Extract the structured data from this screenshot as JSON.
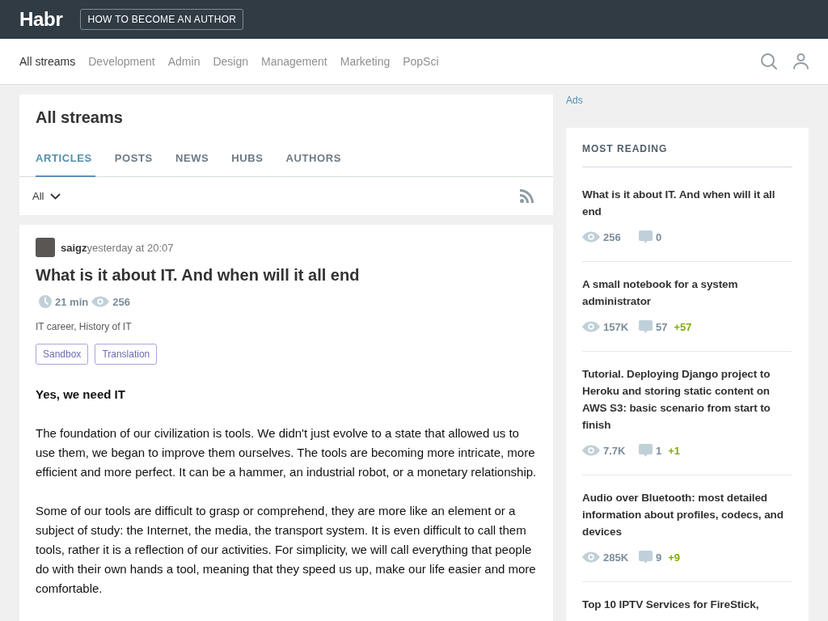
{
  "header": {
    "logo": "Habr",
    "author_button": "HOW TO BECOME AN AUTHOR"
  },
  "nav": {
    "items": [
      {
        "label": "All streams",
        "selected": true
      },
      {
        "label": "Development",
        "selected": false
      },
      {
        "label": "Admin",
        "selected": false
      },
      {
        "label": "Design",
        "selected": false
      },
      {
        "label": "Management",
        "selected": false
      },
      {
        "label": "Marketing",
        "selected": false
      },
      {
        "label": "PopSci",
        "selected": false
      }
    ]
  },
  "streams": {
    "title": "All streams",
    "tabs": [
      {
        "label": "ARTICLES",
        "selected": true
      },
      {
        "label": "POSTS",
        "selected": false
      },
      {
        "label": "NEWS",
        "selected": false
      },
      {
        "label": "HUBS",
        "selected": false
      },
      {
        "label": "AUTHORS",
        "selected": false
      }
    ],
    "filter": "All"
  },
  "article": {
    "author": "saigz",
    "time": "yesterday at 20:07",
    "title": "What is it about IT. And when will it all end",
    "reading_time": "21 min",
    "views": "256",
    "hubs": "IT career, History of IT",
    "tags": [
      "Sandbox",
      "Translation"
    ],
    "body": [
      {
        "kind": "heading",
        "text": "Yes, we need IT"
      },
      {
        "kind": "paragraph",
        "text": "The foundation of our civilization is tools. We didn't just evolve to a state that allowed us to use them, we began to improve them ourselves. The tools are becoming more intricate, more efficient and more perfect. It can be a hammer, an industrial robot, or a monetary relationship."
      },
      {
        "kind": "paragraph",
        "text": "Some of our tools are difficult to grasp or comprehend, they are more like an element or a subject of study: the Internet, the media, the transport system. It is even difficult to call them tools, rather it is a reflection of our activities. For simplicity, we will call everything that people do with their own hands a tool, meaning that they speed us up, make our life easier and more comfortable."
      }
    ]
  },
  "sidebar": {
    "ads_label": "Ads",
    "most_reading": {
      "title": "MOST READING",
      "items": [
        {
          "title": "What is it about IT. And when will it all end",
          "views": "256",
          "comments": "0"
        },
        {
          "title": "A small notebook for a system administrator",
          "views": "157K",
          "comments": "57",
          "new_comments": "+57"
        },
        {
          "title": "Tutorial. Deploying Django project to Heroku and storing static content on AWS S3: basic scenario from start to finish",
          "views": "7.7K",
          "comments": "1",
          "new_comments": "+1"
        },
        {
          "title": "Audio over Bluetooth: most detailed information about profiles, codecs, and devices",
          "views": "285K",
          "comments": "9",
          "new_comments": "+9"
        },
        {
          "title": "Top 10 IPTV Services for FireStick,"
        }
      ]
    }
  }
}
